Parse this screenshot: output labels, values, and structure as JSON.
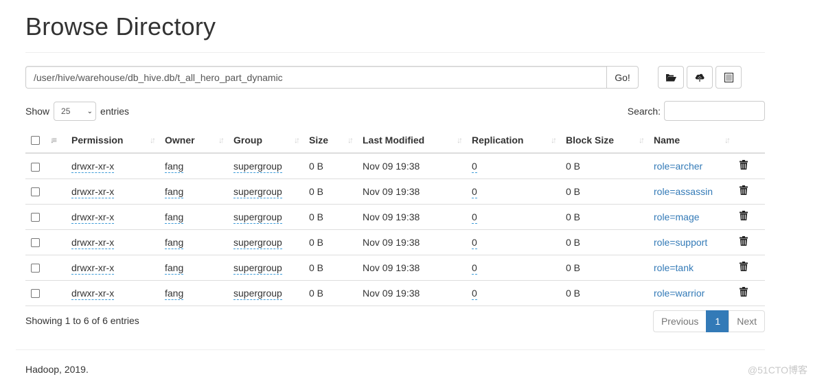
{
  "page": {
    "title": "Browse Directory",
    "path_value": "/user/hive/warehouse/db_hive.db/t_all_hero_part_dynamic",
    "go_label": "Go!",
    "toolbar": [
      {
        "icon": "folder-open-icon",
        "name": "create-directory-button"
      },
      {
        "icon": "cloud-upload-icon",
        "name": "upload-files-button"
      },
      {
        "icon": "list-alt-icon",
        "name": "cut-paste-button"
      }
    ]
  },
  "table_controls": {
    "show_label": "Show",
    "page_size": "25",
    "entries_label": "entries",
    "search_label": "Search:",
    "search_value": ""
  },
  "table": {
    "columns": [
      "Permission",
      "Owner",
      "Group",
      "Size",
      "Last Modified",
      "Replication",
      "Block Size",
      "Name"
    ],
    "rows": [
      {
        "permission": "drwxr-xr-x",
        "owner": "fang",
        "group": "supergroup",
        "size": "0 B",
        "modified": "Nov 09 19:38",
        "replication": "0",
        "block_size": "0 B",
        "name": "role=archer"
      },
      {
        "permission": "drwxr-xr-x",
        "owner": "fang",
        "group": "supergroup",
        "size": "0 B",
        "modified": "Nov 09 19:38",
        "replication": "0",
        "block_size": "0 B",
        "name": "role=assassin"
      },
      {
        "permission": "drwxr-xr-x",
        "owner": "fang",
        "group": "supergroup",
        "size": "0 B",
        "modified": "Nov 09 19:38",
        "replication": "0",
        "block_size": "0 B",
        "name": "role=mage"
      },
      {
        "permission": "drwxr-xr-x",
        "owner": "fang",
        "group": "supergroup",
        "size": "0 B",
        "modified": "Nov 09 19:38",
        "replication": "0",
        "block_size": "0 B",
        "name": "role=support"
      },
      {
        "permission": "drwxr-xr-x",
        "owner": "fang",
        "group": "supergroup",
        "size": "0 B",
        "modified": "Nov 09 19:38",
        "replication": "0",
        "block_size": "0 B",
        "name": "role=tank"
      },
      {
        "permission": "drwxr-xr-x",
        "owner": "fang",
        "group": "supergroup",
        "size": "0 B",
        "modified": "Nov 09 19:38",
        "replication": "0",
        "block_size": "0 B",
        "name": "role=warrior"
      }
    ]
  },
  "pagination": {
    "info": "Showing 1 to 6 of 6 entries",
    "previous": "Previous",
    "current": "1",
    "next": "Next"
  },
  "footer": {
    "text": "Hadoop, 2019.",
    "watermark": "@51CTO博客"
  },
  "colors": {
    "link": "#337ab7",
    "active_page": "#337ab7",
    "dotted_underline": "#3c9bd8",
    "border": "#dddddd"
  }
}
